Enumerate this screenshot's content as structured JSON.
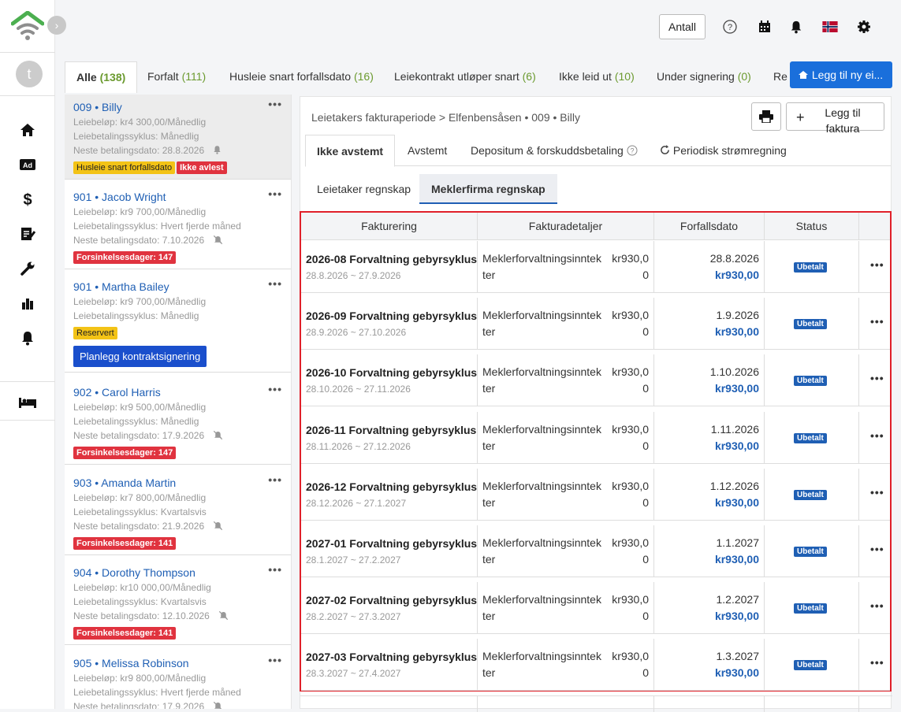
{
  "sidebar": {
    "avatar_letter": "t",
    "nav_icons": [
      "home-icon",
      "ad-icon",
      "dollar-icon",
      "contract-icon",
      "wrench-icon",
      "bar-chart-icon",
      "bell-icon",
      "bed-icon"
    ]
  },
  "topbar": {
    "antall_label": "Antall",
    "icons": [
      "help-icon",
      "calendar-icon",
      "bell-icon",
      "norway-flag-icon",
      "gear-icon"
    ]
  },
  "filter_tabs": [
    {
      "label": "Alle",
      "count": "(138)"
    },
    {
      "label": "Forfalt",
      "count": "(111)"
    },
    {
      "label": "Husleie snart forfallsdato",
      "count": "(16)"
    },
    {
      "label": "Leiekontrakt utløper snart",
      "count": "(6)"
    },
    {
      "label": "Ikke leid ut",
      "count": "(10)"
    },
    {
      "label": "Under signering",
      "count": "(0)"
    },
    {
      "label": "Re",
      "count": ""
    }
  ],
  "add_new_label": "Legg til ny ei...",
  "tenants": [
    {
      "num": "009",
      "name": "Billy",
      "rent": "Leiebeløp: kr4 300,00/Månedlig",
      "cycle": "Leiebetalingssyklus: Månedlig",
      "next": "Neste betalingsdato:  28.8.2026",
      "badges": [
        {
          "text": "Husleie snart forfallsdato",
          "type": "yellow"
        },
        {
          "text": "Ikke avlest",
          "type": "red"
        }
      ]
    },
    {
      "num": "901",
      "name": "Jacob Wright",
      "rent": "Leiebeløp: kr9 700,00/Månedlig",
      "cycle": "Leiebetalingssyklus: Hvert fjerde måned",
      "next": "Neste betalingsdato:  7.10.2026",
      "badges": [
        {
          "text": "Forsinkelsesdager: 147",
          "type": "red"
        }
      ]
    },
    {
      "num": "901",
      "name": "Martha Bailey",
      "rent": "Leiebeløp: kr9 700,00/Månedlig",
      "cycle": "Leiebetalingssyklus: Månedlig",
      "next": "",
      "badges": [
        {
          "text": "Reservert",
          "type": "yellow"
        }
      ],
      "action": "Planlegg kontraktsignering"
    },
    {
      "num": "902",
      "name": "Carol Harris",
      "rent": "Leiebeløp: kr9 500,00/Månedlig",
      "cycle": "Leiebetalingssyklus: Månedlig",
      "next": "Neste betalingsdato:  17.9.2026",
      "badges": [
        {
          "text": "Forsinkelsesdager: 147",
          "type": "red"
        }
      ]
    },
    {
      "num": "903",
      "name": "Amanda Martin",
      "rent": "Leiebeløp: kr7 800,00/Månedlig",
      "cycle": "Leiebetalingssyklus: Kvartalsvis",
      "next": "Neste betalingsdato:  21.9.2026",
      "badges": [
        {
          "text": "Forsinkelsesdager: 141",
          "type": "red"
        }
      ]
    },
    {
      "num": "904",
      "name": "Dorothy Thompson",
      "rent": "Leiebeløp: kr10 000,00/Månedlig",
      "cycle": "Leiebetalingssyklus: Kvartalsvis",
      "next": "Neste betalingsdato:  12.10.2026",
      "badges": [
        {
          "text": "Forsinkelsesdager: 141",
          "type": "red"
        }
      ]
    },
    {
      "num": "905",
      "name": "Melissa Robinson",
      "rent": "Leiebeløp: kr9 800,00/Månedlig",
      "cycle": "Leiebetalingssyklus: Hvert fjerde måned",
      "next": "Neste betalingsdato:  17.9.2026",
      "badges": []
    }
  ],
  "main": {
    "breadcrumb": "Leietakers fakturaperiode >  Elfenbensåsen • 009 • Billy",
    "add_invoice_label": "Legg til faktura",
    "subtabs": [
      "Ikke avstemt",
      "Avstemt",
      "Depositum & forskuddsbetaling",
      "Periodisk strømregning"
    ],
    "account_tabs": [
      "Leietaker regnskap",
      "Meklerfirma regnskap"
    ],
    "table_headers": [
      "Fakturering",
      "Fakturadetaljer",
      "Forfallsdato",
      "Status",
      ""
    ],
    "rows": [
      {
        "title": "2026-08 Forvaltning gebyrsyklus",
        "range": "28.8.2026 ~ 27.9.2026",
        "det1": "Meklerforvaltningsinntek",
        "det2": "ter",
        "amt1": "kr930,0",
        "amt2": "0",
        "date": "28.8.2026",
        "due": "kr930,00",
        "status": "Ubetalt"
      },
      {
        "title": "2026-09 Forvaltning gebyrsyklus",
        "range": "28.9.2026 ~ 27.10.2026",
        "det1": "Meklerforvaltningsinntek",
        "det2": "ter",
        "amt1": "kr930,0",
        "amt2": "0",
        "date": "1.9.2026",
        "due": "kr930,00",
        "status": "Ubetalt"
      },
      {
        "title": "2026-10 Forvaltning gebyrsyklus",
        "range": "28.10.2026 ~ 27.11.2026",
        "det1": "Meklerforvaltningsinntek",
        "det2": "ter",
        "amt1": "kr930,0",
        "amt2": "0",
        "date": "1.10.2026",
        "due": "kr930,00",
        "status": "Ubetalt"
      },
      {
        "title": "2026-11 Forvaltning gebyrsyklus",
        "range": "28.11.2026 ~ 27.12.2026",
        "det1": "Meklerforvaltningsinntek",
        "det2": "ter",
        "amt1": "kr930,0",
        "amt2": "0",
        "date": "1.11.2026",
        "due": "kr930,00",
        "status": "Ubetalt"
      },
      {
        "title": "2026-12 Forvaltning gebyrsyklus",
        "range": "28.12.2026 ~ 27.1.2027",
        "det1": "Meklerforvaltningsinntek",
        "det2": "ter",
        "amt1": "kr930,0",
        "amt2": "0",
        "date": "1.12.2026",
        "due": "kr930,00",
        "status": "Ubetalt"
      },
      {
        "title": "2027-01 Forvaltning gebyrsyklus",
        "range": "28.1.2027 ~ 27.2.2027",
        "det1": "Meklerforvaltningsinntek",
        "det2": "ter",
        "amt1": "kr930,0",
        "amt2": "0",
        "date": "1.1.2027",
        "due": "kr930,00",
        "status": "Ubetalt"
      },
      {
        "title": "2027-02 Forvaltning gebyrsyklus",
        "range": "28.2.2027 ~ 27.3.2027",
        "det1": "Meklerforvaltningsinntek",
        "det2": "ter",
        "amt1": "kr930,0",
        "amt2": "0",
        "date": "1.2.2027",
        "due": "kr930,00",
        "status": "Ubetalt"
      },
      {
        "title": "2027-03 Forvaltning gebyrsyklus",
        "range": "28.3.2027 ~ 27.4.2027",
        "det1": "Meklerforvaltningsinntek",
        "det2": "ter",
        "amt1": "kr930,0",
        "amt2": "0",
        "date": "1.3.2027",
        "due": "kr930,00",
        "status": "Ubetalt"
      }
    ]
  },
  "colors": {
    "accent": "#1a6fdb",
    "link": "#1f5fb4",
    "danger": "#e0333f",
    "warning": "#f3c316",
    "highlight_border": "#e0202a"
  }
}
